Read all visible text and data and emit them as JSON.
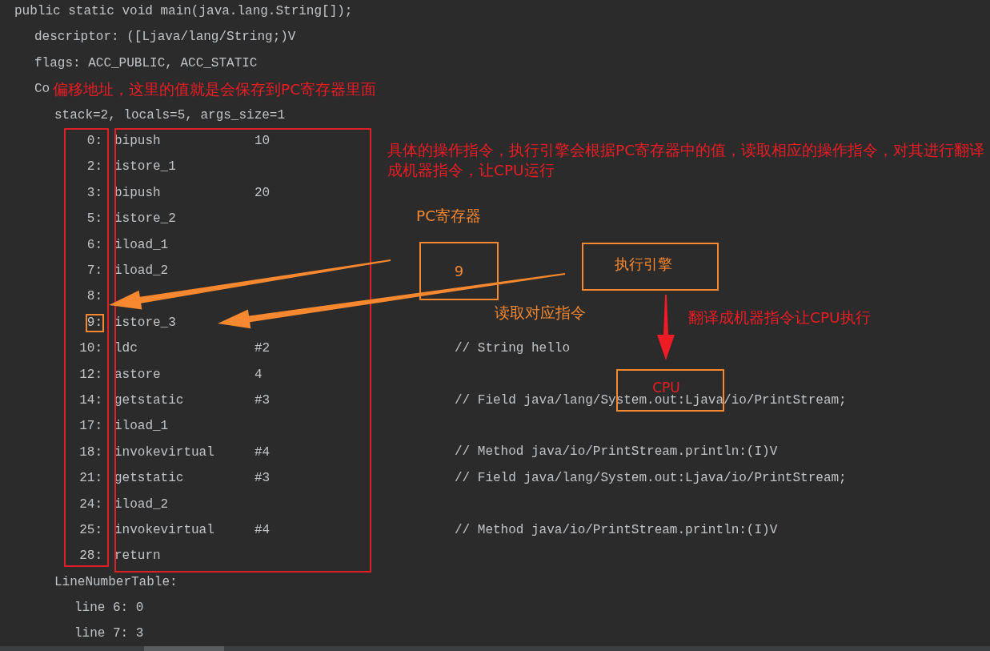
{
  "code": {
    "text": "public static void main(java.lang.String[]);",
    "children": [
      {
        "kind": "line",
        "text": "descriptor: ([Ljava/lang/String;)V"
      },
      {
        "kind": "line",
        "text": "flags: ACC_PUBLIC, ACC_STATIC"
      },
      {
        "kind": "line",
        "text": "Co",
        "children": [
          {
            "kind": "line",
            "text": "stack=2, locals=5, args_size=1"
          },
          {
            "kind": "instructions",
            "rows": [
              {
                "offset": "0:",
                "op": "bipush",
                "arg": "10",
                "highlighted": false
              },
              {
                "offset": "2:",
                "op": "istore_1",
                "highlighted": false
              },
              {
                "offset": "3:",
                "op": "bipush",
                "arg": "20",
                "highlighted": false
              },
              {
                "offset": "5:",
                "op": "istore_2",
                "highlighted": false
              },
              {
                "offset": "6:",
                "op": "iload_1",
                "highlighted": false
              },
              {
                "offset": "7:",
                "op": "iload_2",
                "highlighted": false
              },
              {
                "offset": "8:",
                "highlighted": false
              },
              {
                "offset": "9:",
                "op": "istore_3",
                "highlighted": true
              },
              {
                "offset": "10:",
                "op": "ldc",
                "arg": "#2",
                "comment": "// String hello",
                "highlighted": false
              },
              {
                "offset": "12:",
                "op": "astore",
                "arg": "4",
                "highlighted": false
              },
              {
                "offset": "14:",
                "op": "getstatic",
                "arg": "#3",
                "comment": "// Field java/lang/System.out:Ljava/io/PrintStream;",
                "highlighted": false
              },
              {
                "offset": "17:",
                "op": "iload_1",
                "highlighted": false
              },
              {
                "offset": "18:",
                "op": "invokevirtual",
                "arg": "#4",
                "comment": "// Method java/io/PrintStream.println:(I)V",
                "highlighted": false
              },
              {
                "offset": "21:",
                "op": "getstatic",
                "arg": "#3",
                "comment": "// Field java/lang/System.out:Ljava/io/PrintStream;",
                "highlighted": false
              },
              {
                "offset": "24:",
                "op": "iload_2",
                "highlighted": false
              },
              {
                "offset": "25:",
                "op": "invokevirtual",
                "arg": "#4",
                "comment": "// Method java/io/PrintStream.println:(I)V",
                "highlighted": false
              },
              {
                "offset": "28:",
                "op": "return",
                "highlighted": false
              }
            ]
          },
          {
            "kind": "line",
            "text": "LineNumberTable:",
            "children": [
              {
                "kind": "line",
                "text": "line 6: 0"
              },
              {
                "kind": "line",
                "text": "line 7: 3"
              }
            ]
          }
        ]
      }
    ]
  },
  "annotations": {
    "offset_note": "偏移地址，这里的值就是会保存到PC寄存器里面",
    "instruction_note": "具体的操作指令，执行引擎会根据PC寄存器中的值，读取相应的操作指令，对其进行翻译成机器指令，让CPU运行",
    "pc_register": {
      "label": "PC寄存器",
      "value": "9"
    },
    "engine": {
      "label": "执行引擎"
    },
    "read_label": "读取对应指令",
    "translate_label": "翻译成机器指令让CPU执行",
    "cpu": {
      "label": "CPU"
    }
  }
}
